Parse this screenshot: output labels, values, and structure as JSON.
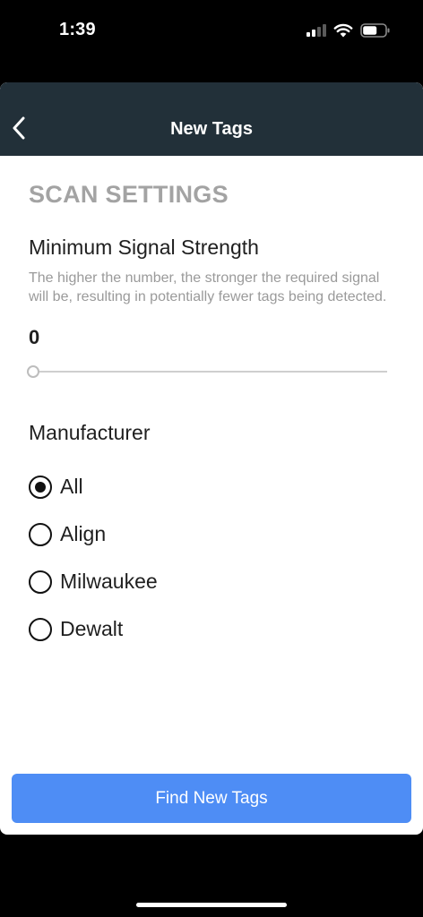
{
  "status_bar": {
    "time": "1:39",
    "icons": [
      "signal-icon",
      "wifi-icon",
      "battery-icon"
    ]
  },
  "navbar": {
    "title": "New Tags",
    "back_icon": "chevron-left-icon"
  },
  "scan_settings": {
    "section_title": "SCAN SETTINGS",
    "signal_strength": {
      "title": "Minimum Signal Strength",
      "description": "The higher the number, the stronger the required signal will be, resulting in potentially fewer tags being detected.",
      "value": "0",
      "slider_fraction": 0
    },
    "manufacturer": {
      "title": "Manufacturer",
      "options": [
        {
          "label": "All",
          "selected": true
        },
        {
          "label": "Align",
          "selected": false
        },
        {
          "label": "Milwaukee",
          "selected": false
        },
        {
          "label": "Dewalt",
          "selected": false
        }
      ]
    }
  },
  "actions": {
    "find_label": "Find New Tags"
  },
  "colors": {
    "navbar_bg": "#223039",
    "primary_button": "#4e8df5",
    "section_title": "#a3a3a3"
  }
}
